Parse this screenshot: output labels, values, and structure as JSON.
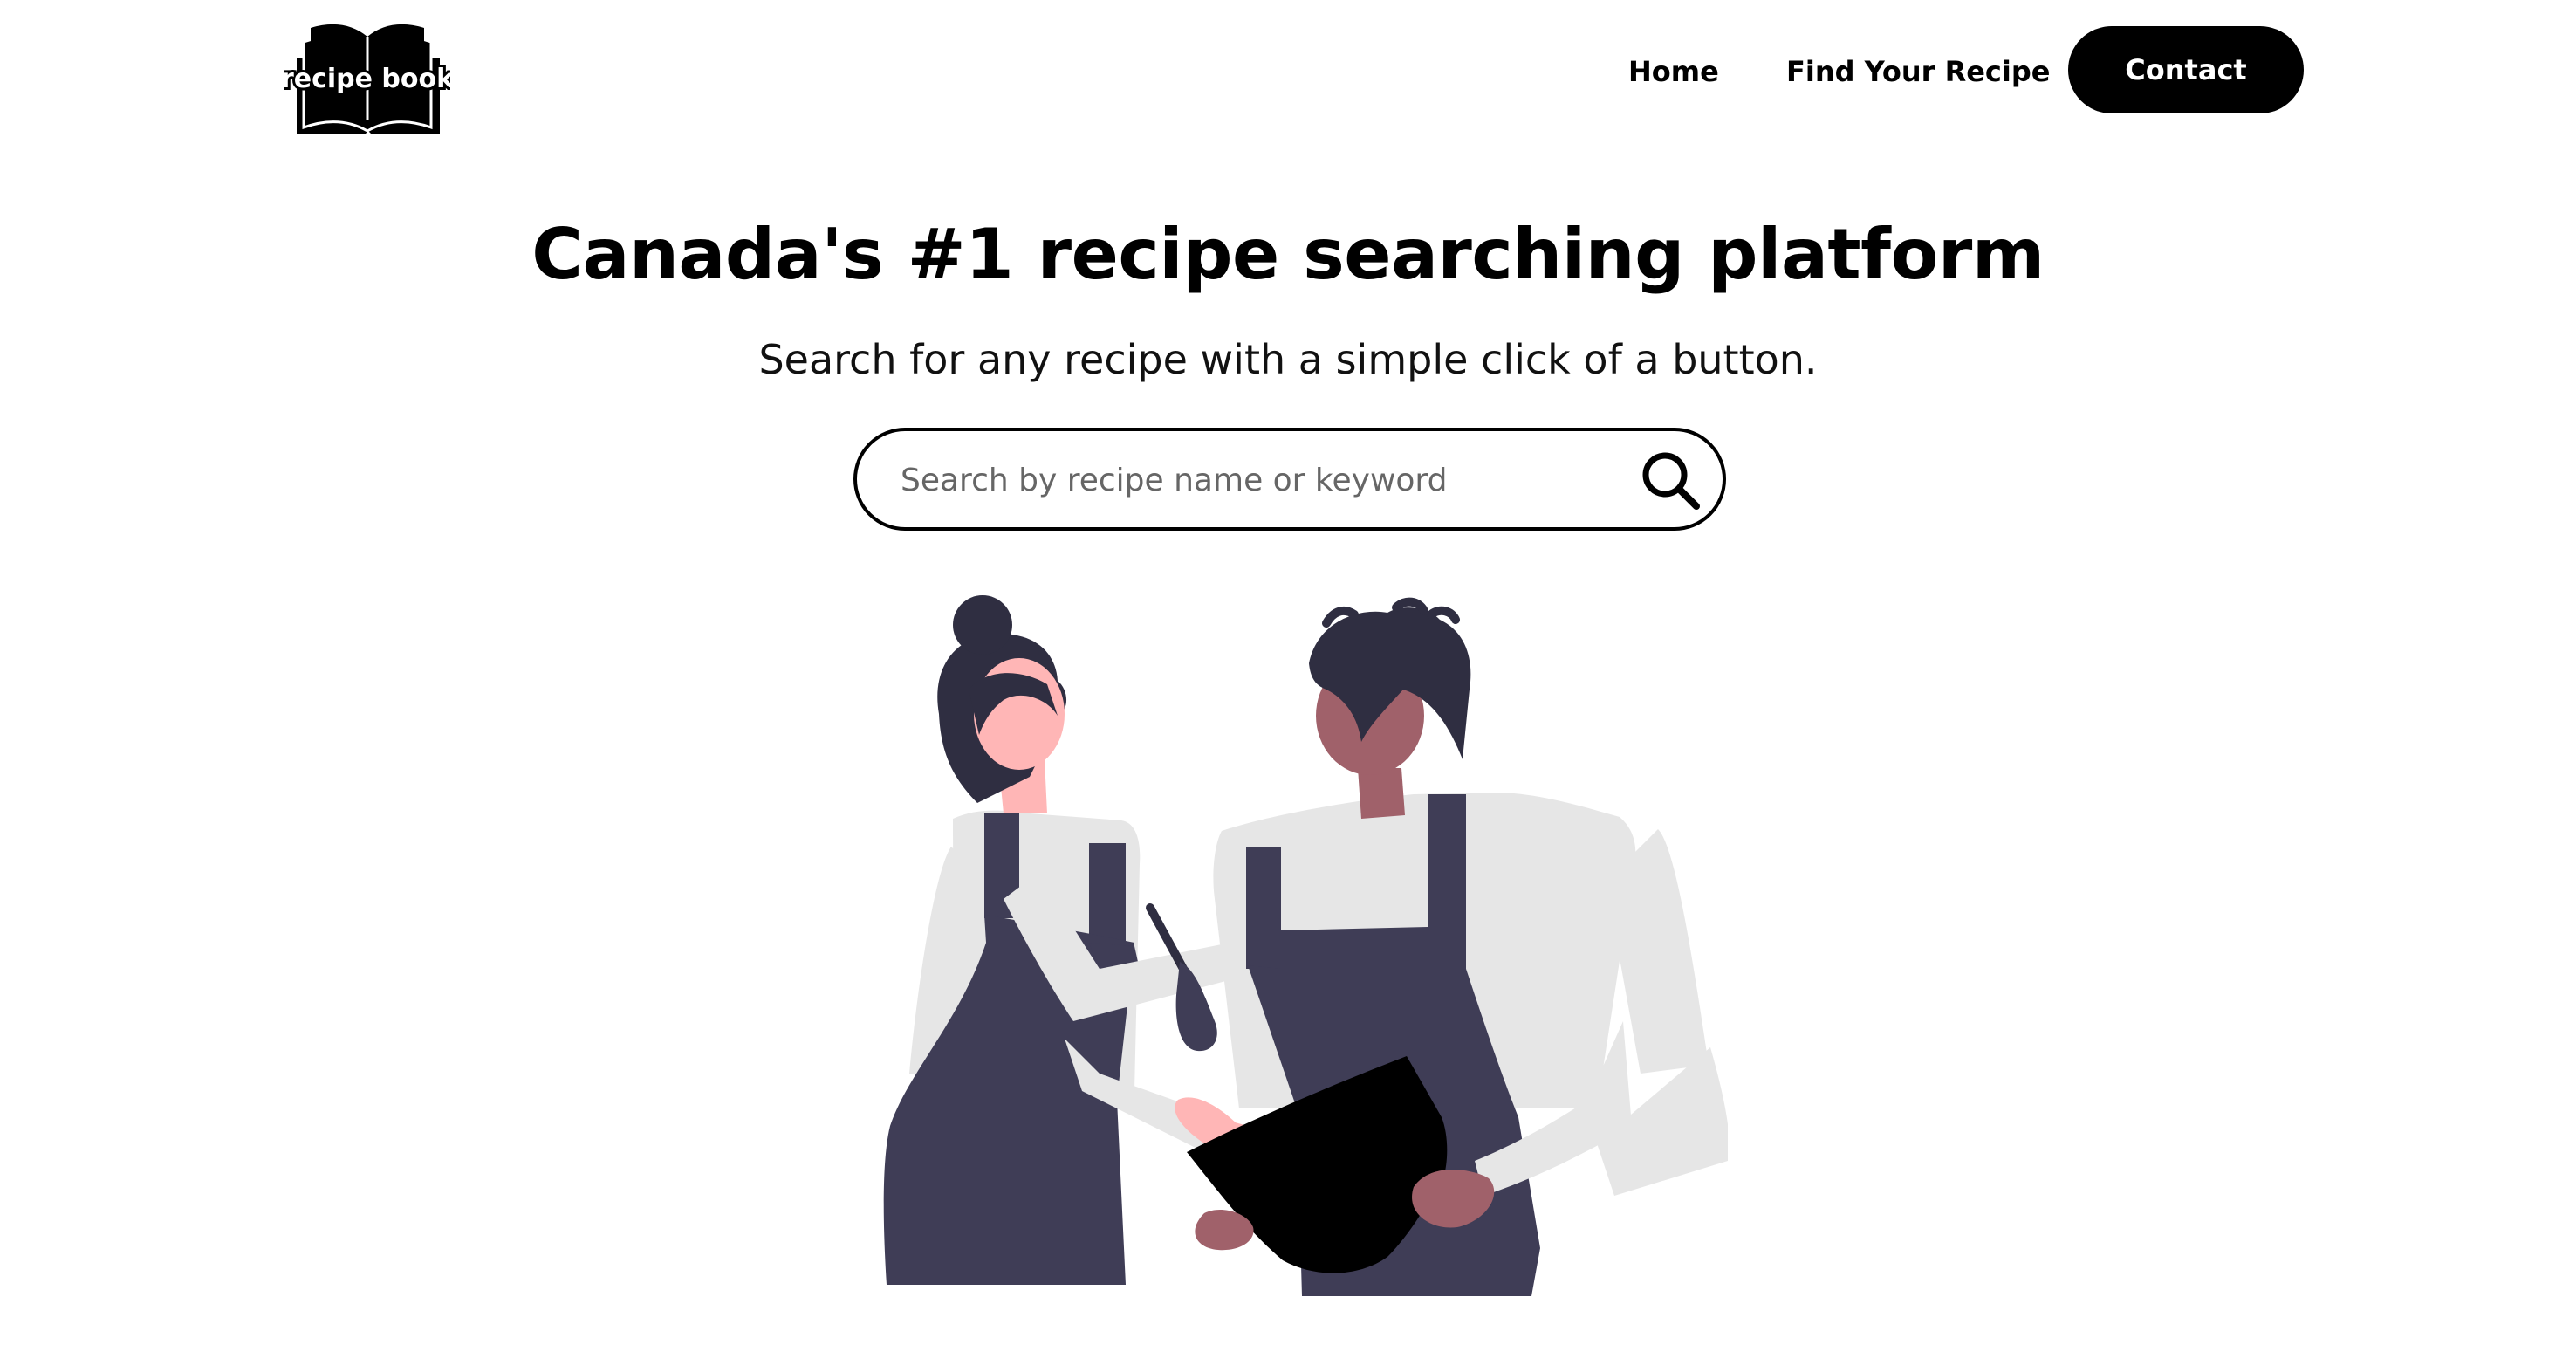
{
  "header": {
    "logo_text": "recipe book",
    "nav": {
      "home": "Home",
      "find_recipe": "Find Your Recipe",
      "contact": "Contact"
    }
  },
  "hero": {
    "title": "Canada's #1 recipe searching platform",
    "subtitle": "Search for any recipe with a simple click of a button."
  },
  "search": {
    "placeholder": "Search by recipe name or keyword",
    "value": "",
    "icon": "search-icon"
  },
  "illustration": {
    "description_icon": "two-chefs-cooking-illustration"
  },
  "colors": {
    "primary": "#000000",
    "apron": "#3f3d56",
    "hair": "#2f2e41",
    "skin_light": "#ffb6b6",
    "skin_dark": "#a0616a",
    "shirt": "#e6e6e6"
  }
}
